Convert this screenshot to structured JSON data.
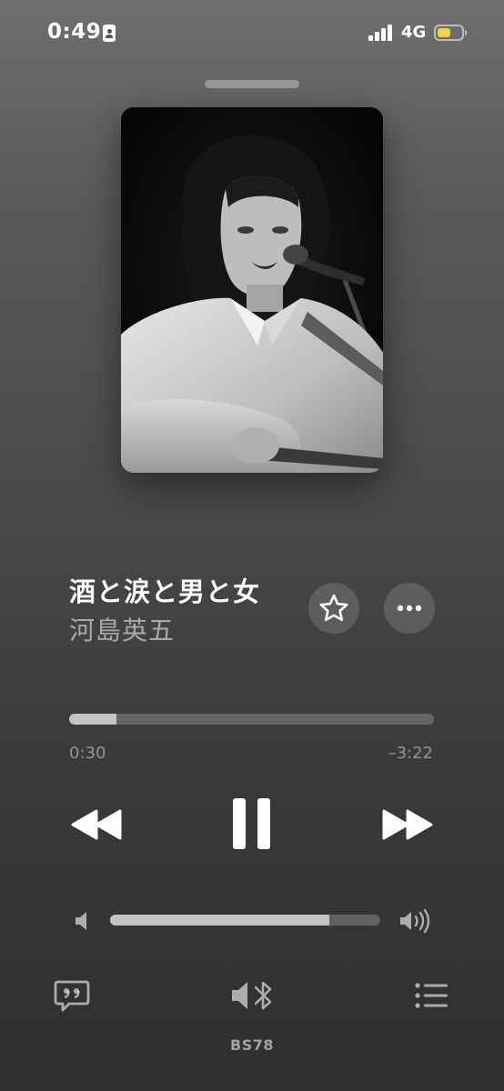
{
  "status_bar": {
    "time": "0:49",
    "network": "4G",
    "battery_fill_color": "#f5d33c"
  },
  "track": {
    "title": "酒と涙と男と女",
    "artist": "河島英五"
  },
  "playback": {
    "elapsed": "0:30",
    "remaining": "–3:22",
    "progress_fraction": 0.13
  },
  "volume": {
    "level_fraction": 0.81
  },
  "output": {
    "device_name": "BS78"
  },
  "icons": {
    "status": [
      "id-card-icon",
      "signal-icon",
      "battery-icon"
    ],
    "actions": [
      "star-icon",
      "ellipsis-icon"
    ],
    "transport": [
      "backward-icon",
      "pause-icon",
      "forward-icon"
    ],
    "volume": [
      "speaker-low-icon",
      "speaker-high-icon"
    ],
    "bottom": [
      "lyrics-quote-icon",
      "speaker-bluetooth-icon",
      "list-icon"
    ]
  },
  "colors": {
    "accent": "#ffffff",
    "muted_text": "#8c8c8c"
  }
}
